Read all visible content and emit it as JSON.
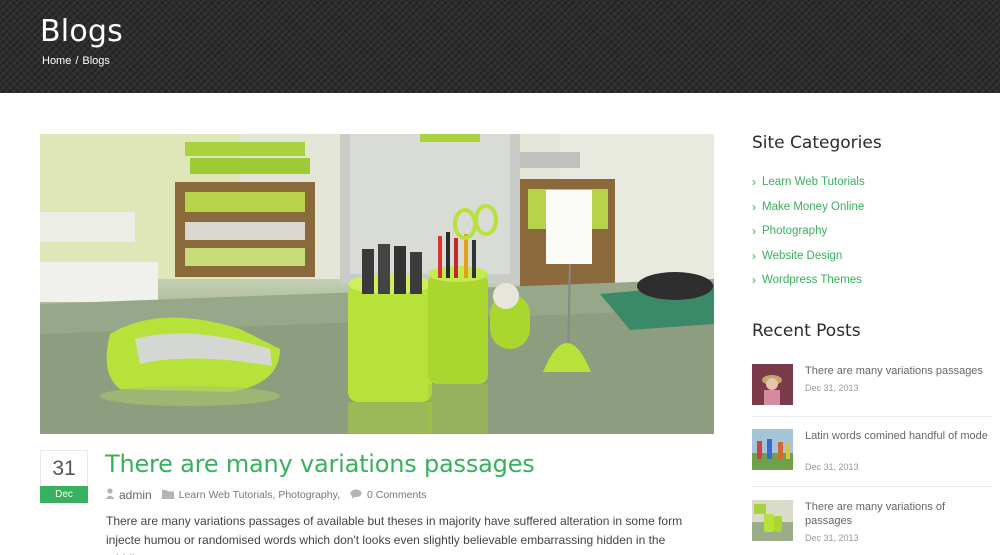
{
  "header": {
    "title": "Blogs",
    "breadcrumb": {
      "home": "Home",
      "separator": "/",
      "current": "Blogs"
    }
  },
  "post": {
    "date_day": "31",
    "date_month": "Dec",
    "title": "There are many variations passages",
    "author": "admin",
    "categories": [
      "Learn Web Tutorials",
      "Photography"
    ],
    "comments": "0 Comments",
    "excerpt": "There are many variations passages of available but theses in majority have suffered alteration in some form injecte humou or randomised words which don't looks even slightly believable embarrassing hidden in the middle."
  },
  "sidebar": {
    "categories_title": "Site Categories",
    "categories": [
      "Learn Web Tutorials",
      "Make Money Online",
      "Photography",
      "Website Design",
      "Wordpress Themes"
    ],
    "recent_title": "Recent Posts",
    "recent_posts": [
      {
        "title": "There are many variations passages",
        "date": "Dec 31, 2013"
      },
      {
        "title": "Latin words comined handful of mode",
        "date": "Dec 31, 2013"
      },
      {
        "title": "There are many variations of passages",
        "date": "Dec 31, 2013"
      }
    ]
  },
  "colors": {
    "accent": "#37b15b",
    "banner": "#2d2d2d"
  },
  "icons": {
    "author": "user-icon",
    "category": "folder-icon",
    "comments": "comment-icon",
    "bullet": "chevron-right-icon"
  }
}
